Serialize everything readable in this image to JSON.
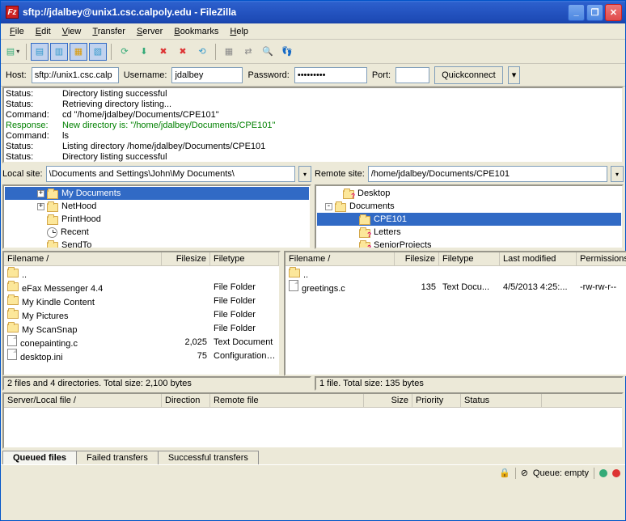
{
  "title": "sftp://jdalbey@unix1.csc.calpoly.edu - FileZilla",
  "menubar": [
    "File",
    "Edit",
    "View",
    "Transfer",
    "Server",
    "Bookmarks",
    "Help"
  ],
  "quickbar": {
    "host_label": "Host:",
    "host_value": "sftp://unix1.csc.calp",
    "user_label": "Username:",
    "user_value": "jdalbey",
    "pass_label": "Password:",
    "pass_value": "•••••••••",
    "port_label": "Port:",
    "port_value": "",
    "connect": "Quickconnect"
  },
  "log": [
    {
      "label": "Status:",
      "text": "Directory listing successful",
      "cls": ""
    },
    {
      "label": "Status:",
      "text": "Retrieving directory listing...",
      "cls": ""
    },
    {
      "label": "Command:",
      "text": "cd \"/home/jdalbey/Documents/CPE101\"",
      "cls": ""
    },
    {
      "label": "Response:",
      "text": "New directory is: \"/home/jdalbey/Documents/CPE101\"",
      "cls": "green"
    },
    {
      "label": "Command:",
      "text": "ls",
      "cls": ""
    },
    {
      "label": "Status:",
      "text": "Listing directory /home/jdalbey/Documents/CPE101",
      "cls": ""
    },
    {
      "label": "Status:",
      "text": "Directory listing successful",
      "cls": ""
    }
  ],
  "local_site_label": "Local site:",
  "local_site_value": "\\Documents and Settings\\John\\My Documents\\",
  "remote_site_label": "Remote site:",
  "remote_site_value": "/home/jdalbey/Documents/CPE101",
  "local_tree": [
    {
      "indent": 40,
      "toggle": "+",
      "icon": "folder",
      "label": "My Documents",
      "selected": true
    },
    {
      "indent": 40,
      "toggle": "+",
      "icon": "folder",
      "label": "NetHood"
    },
    {
      "indent": 40,
      "toggle": "",
      "icon": "folder",
      "label": "PrintHood"
    },
    {
      "indent": 40,
      "toggle": "",
      "icon": "recent",
      "label": "Recent"
    },
    {
      "indent": 40,
      "toggle": "",
      "icon": "folder",
      "label": "SendTo"
    }
  ],
  "remote_tree": [
    {
      "indent": 20,
      "toggle": "",
      "icon": "folder-qm",
      "label": "Desktop"
    },
    {
      "indent": 10,
      "toggle": "-",
      "icon": "folder",
      "label": "Documents"
    },
    {
      "indent": 40,
      "toggle": "",
      "icon": "folder",
      "label": "CPE101",
      "selected": true
    },
    {
      "indent": 40,
      "toggle": "",
      "icon": "folder-qm",
      "label": "Letters"
    },
    {
      "indent": 40,
      "toggle": "",
      "icon": "folder-qm",
      "label": "SeniorProjects"
    }
  ],
  "local_list_headers": [
    "Filename",
    "Filesize",
    "Filetype"
  ],
  "local_list_widths": [
    195,
    60,
    85
  ],
  "local_list": [
    {
      "name": "..",
      "size": "",
      "type": "",
      "icon": "folder"
    },
    {
      "name": "eFax Messenger 4.4",
      "size": "",
      "type": "File Folder",
      "icon": "folder"
    },
    {
      "name": "My Kindle Content",
      "size": "",
      "type": "File Folder",
      "icon": "folder"
    },
    {
      "name": "My Pictures",
      "size": "",
      "type": "File Folder",
      "icon": "folder"
    },
    {
      "name": "My ScanSnap",
      "size": "",
      "type": "File Folder",
      "icon": "folder"
    },
    {
      "name": "conepainting.c",
      "size": "2,025",
      "type": "Text Document",
      "icon": "file"
    },
    {
      "name": "desktop.ini",
      "size": "75",
      "type": "Configuration S...",
      "icon": "file"
    }
  ],
  "remote_list_headers": [
    "Filename",
    "Filesize",
    "Filetype",
    "Last modified",
    "Permissions"
  ],
  "remote_list_widths": [
    135,
    55,
    75,
    95,
    65
  ],
  "remote_list": [
    {
      "name": "..",
      "size": "",
      "type": "",
      "mod": "",
      "perm": "",
      "icon": "folder"
    },
    {
      "name": "greetings.c",
      "size": "135",
      "type": "Text Docu...",
      "mod": "4/5/2013 4:25:...",
      "perm": "-rw-rw-r--",
      "icon": "file"
    }
  ],
  "local_status": "2 files and 4 directories. Total size: 2,100 bytes",
  "remote_status": "1 file. Total size: 135 bytes",
  "queue_headers": [
    "Server/Local file",
    "Direction",
    "Remote file",
    "Size",
    "Priority",
    "Status"
  ],
  "queue_widths": [
    195,
    60,
    190,
    60,
    60,
    100
  ],
  "tabs": [
    "Queued files",
    "Failed transfers",
    "Successful transfers"
  ],
  "active_tab": 0,
  "footer_queue": "Queue: empty"
}
